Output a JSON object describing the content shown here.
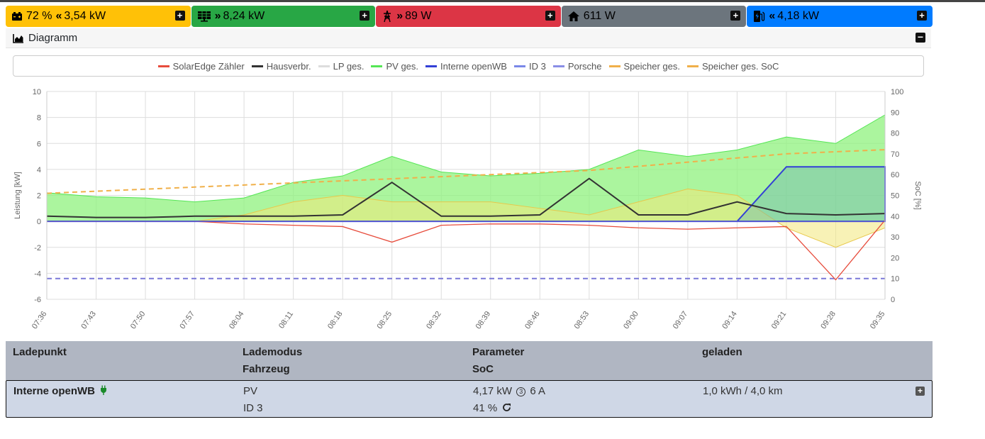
{
  "tiles": {
    "battery": {
      "text": "72 % « 3,54 kW",
      "soc": "72 %",
      "power": "3,54 kW"
    },
    "pv": {
      "power": "8,24 kW"
    },
    "grid": {
      "power": "89 W"
    },
    "house": {
      "power": "611 W"
    },
    "charging": {
      "power": "4,18 kW"
    }
  },
  "diagram": {
    "title": "Diagramm"
  },
  "legend": [
    {
      "label": "SolarEdge Zähler",
      "color": "#e74c3c"
    },
    {
      "label": "Hausverbr.",
      "color": "#333333"
    },
    {
      "label": "LP ges.",
      "color": "#dddddd"
    },
    {
      "label": "PV ges.",
      "color": "#55e655"
    },
    {
      "label": "Interne openWB",
      "color": "#3340d6"
    },
    {
      "label": "ID 3",
      "color": "#7a88e8"
    },
    {
      "label": "Porsche",
      "color": "#8a8ee6"
    },
    {
      "label": "Speicher ges.",
      "color": "#f0b04a"
    },
    {
      "label": "Speicher ges. SoC",
      "color": "#f0b04a"
    }
  ],
  "chart_data": {
    "type": "line",
    "ylabel": "Leistung [kW]",
    "y2label": "SoC [%]",
    "ylim": [
      -6,
      10
    ],
    "y2lim": [
      0,
      100
    ],
    "yticks": [
      "10",
      "8",
      "6",
      "4",
      "2",
      "0",
      "-2",
      "-4",
      "-6"
    ],
    "y2ticks": [
      "100",
      "90",
      "80",
      "70",
      "60",
      "50",
      "40",
      "30",
      "20",
      "10",
      "0"
    ],
    "x": [
      "07:36",
      "07:43",
      "07:50",
      "07:57",
      "08:04",
      "08:11",
      "08:18",
      "08:25",
      "08:32",
      "08:39",
      "08:46",
      "08:53",
      "09:00",
      "09:07",
      "09:14",
      "09:21",
      "09:28",
      "09:35"
    ],
    "series": [
      {
        "name": "PV ges.",
        "values": [
          2.2,
          1.9,
          1.8,
          1.5,
          1.8,
          3.0,
          3.5,
          5.0,
          3.8,
          3.5,
          3.7,
          4.0,
          5.5,
          5.0,
          5.5,
          6.5,
          6.0,
          8.2
        ]
      },
      {
        "name": "Hausverbr.",
        "values": [
          0.4,
          0.3,
          0.3,
          0.4,
          0.4,
          0.4,
          0.5,
          3.0,
          0.4,
          0.4,
          0.5,
          3.3,
          0.5,
          0.5,
          1.5,
          0.6,
          0.5,
          0.6
        ]
      },
      {
        "name": "SolarEdge Zähler",
        "values": [
          0.0,
          0.0,
          0.0,
          0.0,
          -0.2,
          -0.3,
          -0.4,
          -1.6,
          -0.3,
          -0.2,
          -0.2,
          -0.3,
          -0.5,
          -0.6,
          -0.5,
          -0.4,
          -4.5,
          0.1
        ]
      },
      {
        "name": "Interne openWB",
        "values": [
          0,
          0,
          0,
          0,
          0,
          0,
          0,
          0,
          0,
          0,
          0,
          0,
          0,
          0,
          0,
          4.2,
          4.2,
          4.2
        ]
      },
      {
        "name": "Speicher ges.",
        "values": [
          0,
          0,
          0,
          0,
          0.5,
          1.5,
          2.0,
          1.5,
          1.5,
          1.5,
          1.0,
          0.5,
          1.5,
          2.5,
          2.0,
          -0.5,
          -2.0,
          -0.5
        ]
      },
      {
        "name": "Speicher ges. SoC",
        "values": [
          51,
          52,
          53,
          54,
          55,
          56,
          57,
          58,
          59,
          60,
          61,
          62,
          64,
          66,
          68,
          70,
          71,
          72
        ]
      },
      {
        "name": "ID 3",
        "values": [
          10,
          10,
          10,
          10,
          10,
          10,
          10,
          10,
          10,
          10,
          10,
          10,
          10,
          10,
          10,
          10,
          10,
          10
        ]
      }
    ]
  },
  "chargepoints": {
    "header": {
      "ladepunkt": "Ladepunkt",
      "lademodus": "Lademodus",
      "fahrzeug": "Fahrzeug",
      "parameter": "Parameter",
      "soc": "SoC",
      "geladen": "geladen"
    },
    "rows": [
      {
        "name": "Interne openWB",
        "mode": "PV",
        "vehicle": "ID 3",
        "power": "4,17 kW",
        "phases": "3",
        "current": "6 A",
        "soc": "41 %",
        "charged": "1,0 kWh / 4,0 km"
      }
    ]
  }
}
